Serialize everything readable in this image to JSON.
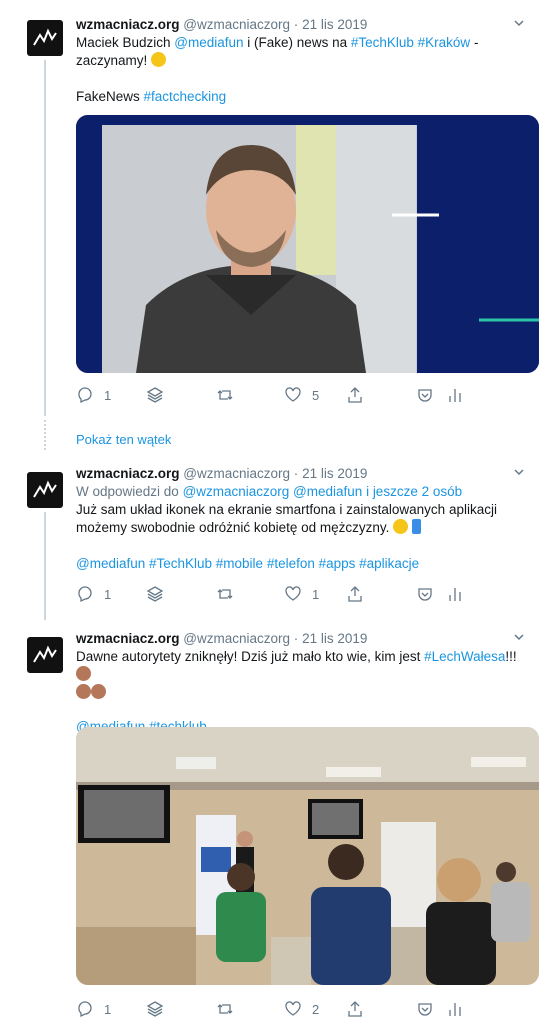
{
  "colors": {
    "link": "#1b95e0",
    "muted": "#657786",
    "line": "#ccd6dd",
    "navy": "#0b1f6b"
  },
  "show_thread": "Pokaż ten wątek",
  "tweets": [
    {
      "name": "wzmacniacz.org",
      "handle": "@wzmacniaczorg",
      "sep": "·",
      "date": "21 lis 2019",
      "text_plain_1": "Maciek Budzich ",
      "mention_1": "@mediafun",
      "text_plain_2": " i (Fake) news na ",
      "tag_1": "#TechKlub",
      "tag_2": "#Kraków",
      "text_plain_3": " -",
      "line2": "zaczynamy!",
      "line3_plain": "FakeNews ",
      "line3_tag": "#factchecking",
      "actions": {
        "reply": "1",
        "like": "5"
      }
    },
    {
      "name": "wzmacniacz.org",
      "handle": "@wzmacniaczorg",
      "sep": "·",
      "date": "21 lis 2019",
      "reply_prefix": "W odpowiedzi do ",
      "reply_to": "@wzmacniaczorg @mediafun",
      "reply_more": "i jeszcze 2 osób",
      "line1": "Już sam układ ikonek na ekranie smartfona i zainstalowanych aplikacji",
      "line2": "możemy swobodnie  odróżnić kobietę od mężczyzny.",
      "tags": "@mediafun #TechKlub #mobile #telefon #apps #aplikacje",
      "actions": {
        "reply": "1",
        "like": "1"
      }
    },
    {
      "name": "wzmacniacz.org",
      "handle": "@wzmacniaczorg",
      "sep": "·",
      "date": "21 lis 2019",
      "line1_plain": "Dawne autorytety zniknęły! Dziś już mało kto wie, kim jest ",
      "line1_tag": "#LechWałesa",
      "line1_end": "!!!",
      "tags": "@mediafun #techklub",
      "actions": {
        "reply": "1",
        "like": "2"
      }
    }
  ]
}
